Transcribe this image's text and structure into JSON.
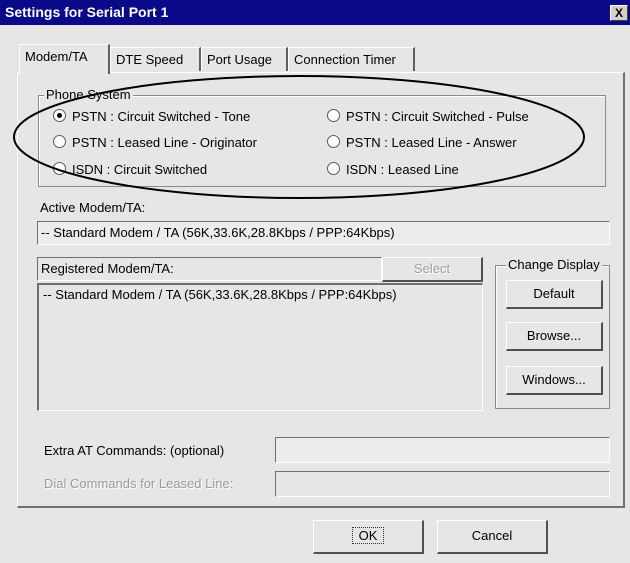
{
  "window": {
    "title": "Settings for Serial Port 1",
    "close_glyph": "X"
  },
  "tabs": [
    {
      "label": "Modem/TA",
      "active": true
    },
    {
      "label": "DTE Speed",
      "active": false
    },
    {
      "label": "Port Usage",
      "active": false
    },
    {
      "label": "Connection Timer",
      "active": false
    }
  ],
  "phone_system": {
    "title": "Phone System",
    "options": [
      {
        "label": "PSTN : Circuit Switched - Tone",
        "checked": true
      },
      {
        "label": "PSTN : Circuit Switched - Pulse",
        "checked": false
      },
      {
        "label": "PSTN : Leased Line - Originator",
        "checked": false
      },
      {
        "label": "PSTN : Leased Line - Answer",
        "checked": false
      },
      {
        "label": "ISDN : Circuit Switched",
        "checked": false
      },
      {
        "label": "ISDN : Leased Line",
        "checked": false
      }
    ]
  },
  "active_modem": {
    "label": "Active Modem/TA:",
    "value": "-- Standard Modem / TA (56K,33.6K,28.8Kbps / PPP:64Kbps)"
  },
  "registered_modem": {
    "label": "Registered Modem/TA:",
    "select_label": "Select",
    "items": [
      "-- Standard Modem / TA (56K,33.6K,28.8Kbps / PPP:64Kbps)"
    ]
  },
  "change_display": {
    "title": "Change Display",
    "default_label": "Default",
    "browse_label": "Browse...",
    "windows_label": "Windows..."
  },
  "extra_at": {
    "label": "Extra AT Commands: (optional)",
    "value": ""
  },
  "dial_leased": {
    "label": "Dial Commands for Leased Line:",
    "value": ""
  },
  "footer": {
    "ok_label": "OK",
    "cancel_label": "Cancel"
  },
  "colors": {
    "titlebar": "#0a0a88",
    "face": "#e6e6e6"
  }
}
